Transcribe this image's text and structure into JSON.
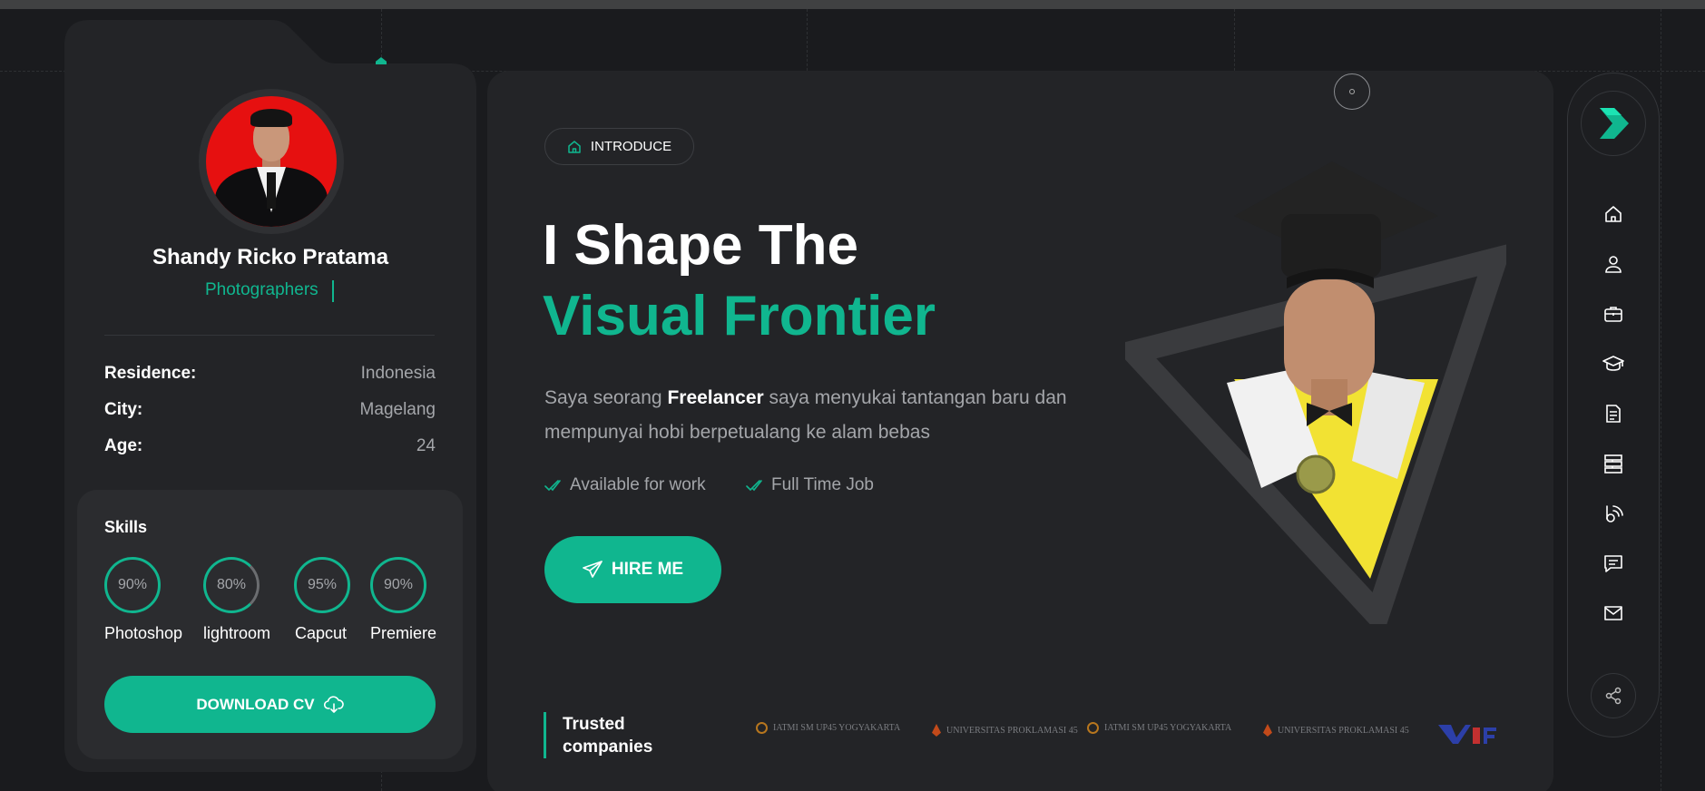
{
  "profile": {
    "name": "Shandy Ricko Pratama",
    "role": "Photographers",
    "info": [
      {
        "label": "Residence:",
        "value": "Indonesia"
      },
      {
        "label": "City:",
        "value": "Magelang"
      },
      {
        "label": "Age:",
        "value": "24"
      }
    ],
    "skills_title": "Skills",
    "skills": [
      {
        "name": "Photoshop",
        "percent_label": "90%",
        "level": 0.9
      },
      {
        "name": "lightroom",
        "percent_label": "80%",
        "level": 0.8
      },
      {
        "name": "Capcut",
        "percent_label": "95%",
        "level": 0.95
      },
      {
        "name": "Premiere",
        "percent_label": "90%",
        "level": 0.9
      }
    ],
    "download_label": "DOWNLOAD CV"
  },
  "hero": {
    "tag": "INTRODUCE",
    "title_line1": "I Shape The",
    "title_line2": "Visual Frontier",
    "desc_pre": "Saya seorang ",
    "desc_bold": "Freelancer",
    "desc_post": " saya menyukai tantangan baru dan mempunyai hobi berpetualang ke alam bebas",
    "checks": [
      "Available for work",
      "Full Time Job"
    ],
    "hire_label": "HIRE ME"
  },
  "trusted": {
    "line1": "Trusted",
    "line2": "companies",
    "logos": [
      "IATMI SM UP45 YOGYAKARTA",
      "UNIVERSITAS PROKLAMASI 45",
      "IATMI SM UP45 YOGYAKARTA",
      "UNIVERSITAS PROKLAMASI 45"
    ]
  },
  "nav": {
    "icons": [
      "home-icon",
      "user-icon",
      "briefcase-icon",
      "graduation-cap-icon",
      "document-icon",
      "server-icon",
      "blog-icon",
      "chat-icon",
      "mail-icon"
    ]
  },
  "colors": {
    "accent": "#10b68f",
    "background": "#1a1b1e",
    "card": "#232427"
  }
}
